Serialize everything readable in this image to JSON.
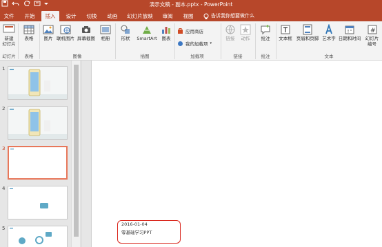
{
  "window": {
    "title": "演示文稿 - 副本.pptx - PowerPoint",
    "quick_access": [
      "save-icon",
      "undo-icon",
      "redo-icon",
      "customize-icon"
    ]
  },
  "tabs": [
    {
      "label": "文件",
      "active": false
    },
    {
      "label": "开始",
      "active": false
    },
    {
      "label": "插入",
      "active": true
    },
    {
      "label": "设计",
      "active": false
    },
    {
      "label": "切换",
      "active": false
    },
    {
      "label": "动画",
      "active": false
    },
    {
      "label": "幻灯片放映",
      "active": false
    },
    {
      "label": "审阅",
      "active": false
    },
    {
      "label": "视图",
      "active": false
    }
  ],
  "tell_me": "告诉我你想要做什么",
  "ribbon": {
    "new_slide": "新建\n幻灯片",
    "group_slides": "幻灯片",
    "table": "表格",
    "group_tables": "表格",
    "picture": "图片",
    "online_picture": "联机图片",
    "screenshot": "屏幕截图",
    "album": "相册",
    "group_images": "图像",
    "shapes": "形状",
    "smartart": "SmartArt",
    "chart": "图表",
    "group_illustrations": "插图",
    "store": "应用商店",
    "my_addins": "我的加载项",
    "group_addins": "加载项",
    "link": "链接",
    "action": "动作",
    "group_links": "链接",
    "comment": "批注",
    "group_comments": "批注",
    "textbox": "文本框",
    "header_footer": "页眉和页脚",
    "wordart": "艺术字",
    "datetime": "日期和时间",
    "slide_number": "幻灯片\n编号",
    "group_text": "文本"
  },
  "slides": [
    {
      "number": "1"
    },
    {
      "number": "2"
    },
    {
      "number": "3",
      "active": true
    },
    {
      "number": "4"
    },
    {
      "number": "5"
    }
  ],
  "current_slide": {
    "date": "2016-01-04",
    "subtitle": "零基础学习PPT"
  },
  "colors": {
    "accent": "#b7472a",
    "annotation": "#d9261c",
    "selected_thumb": "#e8775a"
  }
}
